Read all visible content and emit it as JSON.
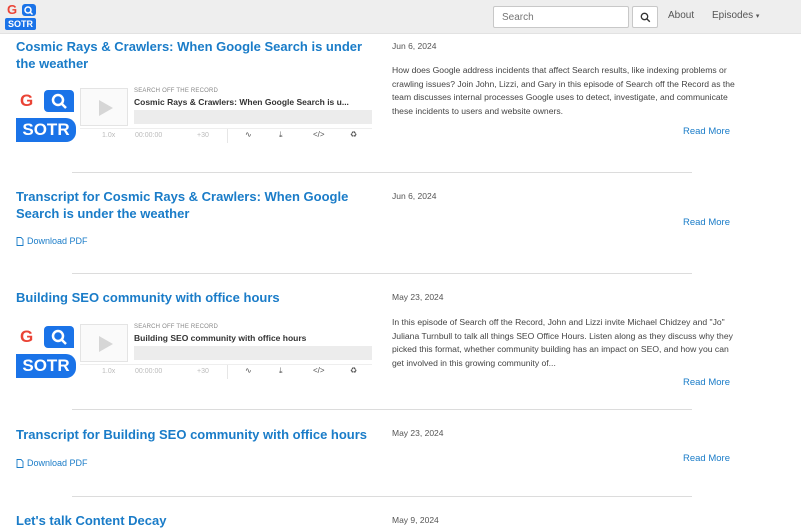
{
  "nav": {
    "logo": {
      "top": "G",
      "bottom": "SOTR"
    },
    "search_placeholder": "Search",
    "about_label": "About",
    "episodes_label": "Episodes"
  },
  "episodes": [
    {
      "title": "Cosmic Rays & Crawlers: When Google Search is under the weather",
      "date": "Jun 6, 2024",
      "description": "How does Google address incidents that affect Search results, like indexing problems or crawling issues? Join John, Lizzi, and Gary in this episode of Search off the Record as the team discusses internal processes Google uses to detect, investigate, and communicate these incidents to users and website owners.",
      "read_more": "Read More",
      "player": {
        "show": "SEARCH OFF THE RECORD",
        "episode": "Cosmic Rays & Crawlers: When Google Search is u...",
        "speed": "1.0x",
        "time": "00:00:00",
        "skip": "+30",
        "art_top": "G",
        "art_bottom": "SOTR"
      }
    },
    {
      "title": "Transcript for Cosmic Rays & Crawlers: When Google Search is under the weather",
      "date": "Jun 6, 2024",
      "pdf": "Download PDF",
      "read_more": "Read More"
    },
    {
      "title": "Building SEO community with office hours",
      "date": "May 23, 2024",
      "description": "In this episode of Search off the Record, John and Lizzi invite Michael Chidzey and \"Jo\" Juliana Turnbull to talk all things SEO Office Hours. Listen along as they discuss why they picked this format, whether community building has an impact on SEO, and how you can get involved in this growing community of...",
      "read_more": "Read More",
      "player": {
        "show": "SEARCH OFF THE RECORD",
        "episode": "Building SEO community with office hours",
        "speed": "1.0x",
        "time": "00:00:00",
        "skip": "+30",
        "art_top": "G",
        "art_bottom": "SOTR"
      }
    },
    {
      "title": "Transcript for Building SEO community with office hours",
      "date": "May 23, 2024",
      "pdf": "Download PDF",
      "read_more": "Read More"
    },
    {
      "title": "Let's talk Content Decay",
      "date": "May 9, 2024"
    }
  ]
}
